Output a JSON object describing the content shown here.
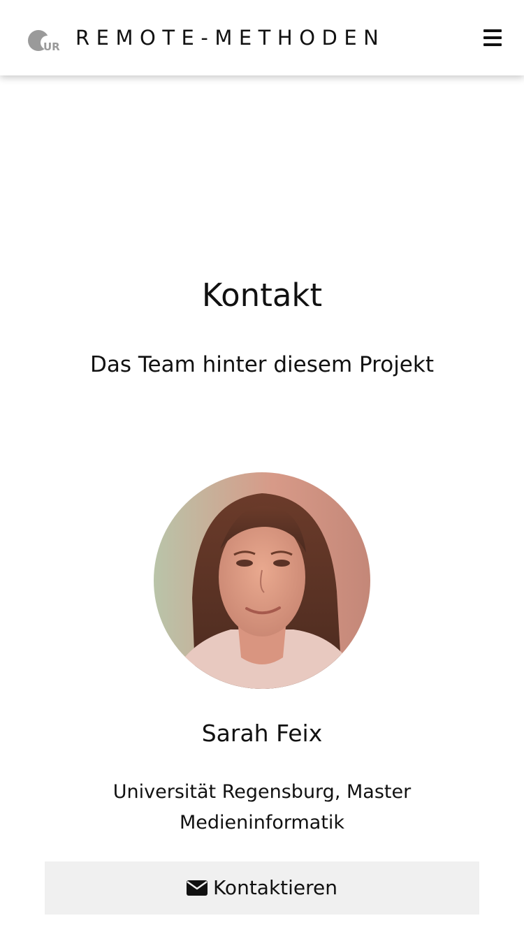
{
  "header": {
    "logo_text": "UR",
    "brand": "REMOTE-METHODEN",
    "menu_icon": "hamburger-menu-icon"
  },
  "main": {
    "title": "Kontakt",
    "subtitle": "Das Team hinter diesem Projekt"
  },
  "member": {
    "name": "Sarah Feix",
    "affiliation": "Universität Regensburg, Master Medieninformatik",
    "contact_label": "Kontaktieren",
    "contact_icon": "envelope-icon"
  },
  "colors": {
    "text": "#111111",
    "logo_gray": "#9a9a9a",
    "button_bg": "#f0f0f0"
  }
}
